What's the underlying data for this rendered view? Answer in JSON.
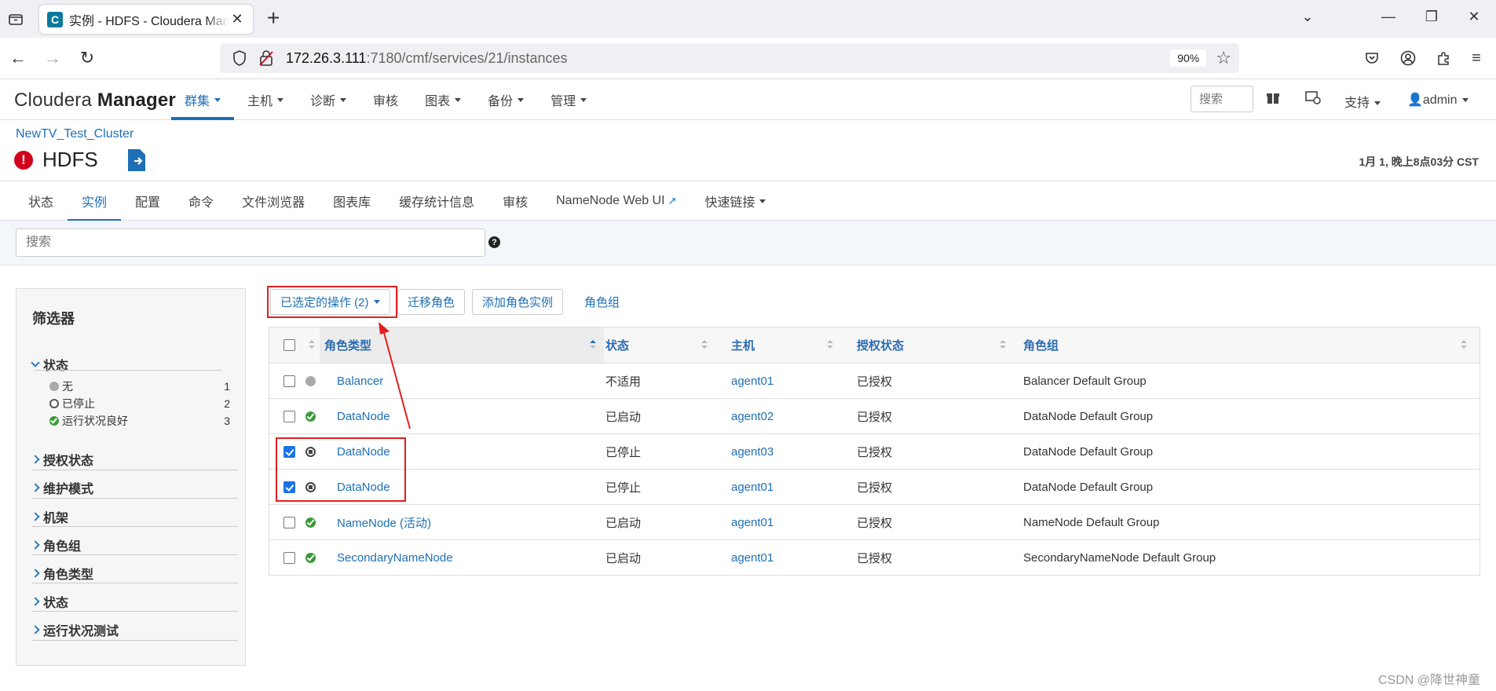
{
  "browser": {
    "tab_title": "实例 - HDFS - Cloudera Manager",
    "url_host": "172.26.3.111",
    "url_path": ":7180/cmf/services/21/instances",
    "zoom": "90%"
  },
  "header": {
    "logo_light": "Cloudera ",
    "logo_bold": "Manager",
    "nav": [
      {
        "label": "群集"
      },
      {
        "label": "主机"
      },
      {
        "label": "诊断"
      },
      {
        "label": "审核"
      },
      {
        "label": "图表"
      },
      {
        "label": "备份"
      },
      {
        "label": "管理"
      }
    ],
    "search_placeholder": "搜索",
    "support": "支持",
    "user": "admin"
  },
  "page": {
    "breadcrumb": "NewTV_Test_Cluster",
    "service": "HDFS",
    "timestamp": "1月 1, 晚上8点03分 CST"
  },
  "subtabs": [
    {
      "label": "状态"
    },
    {
      "label": "实例"
    },
    {
      "label": "配置"
    },
    {
      "label": "命令"
    },
    {
      "label": "文件浏览器"
    },
    {
      "label": "图表库"
    },
    {
      "label": "缓存统计信息"
    },
    {
      "label": "审核"
    },
    {
      "label": "NameNode Web UI"
    },
    {
      "label": "快速链接"
    }
  ],
  "search": {
    "placeholder": "搜索"
  },
  "filters": {
    "title": "筛选器",
    "open_section": "状态",
    "facets": [
      {
        "label": "无",
        "count": "1"
      },
      {
        "label": "已停止",
        "count": "2"
      },
      {
        "label": "运行状况良好",
        "count": "3"
      }
    ],
    "sections": [
      "授权状态",
      "维护模式",
      "机架",
      "角色组",
      "角色类型",
      "状态",
      "运行状况测试"
    ]
  },
  "actions": {
    "selected": "已选定的操作 (2)",
    "migrate": "迁移角色",
    "add": "添加角色实例",
    "groups": "角色组"
  },
  "table": {
    "columns": [
      "角色类型",
      "状态",
      "主机",
      "授权状态",
      "角色组"
    ],
    "rows": [
      {
        "checked": false,
        "health": "na",
        "type": "Balancer",
        "state": "不适用",
        "host": "agent01",
        "auth": "已授权",
        "group": "Balancer Default Group"
      },
      {
        "checked": false,
        "health": "good",
        "type": "DataNode",
        "state": "已启动",
        "host": "agent02",
        "auth": "已授权",
        "group": "DataNode Default Group"
      },
      {
        "checked": true,
        "health": "stopped",
        "type": "DataNode",
        "state": "已停止",
        "host": "agent03",
        "auth": "已授权",
        "group": "DataNode Default Group"
      },
      {
        "checked": true,
        "health": "stopped",
        "type": "DataNode",
        "state": "已停止",
        "host": "agent01",
        "auth": "已授权",
        "group": "DataNode Default Group"
      },
      {
        "checked": false,
        "health": "good",
        "type": "NameNode (活动)",
        "state": "已启动",
        "host": "agent01",
        "auth": "已授权",
        "group": "NameNode Default Group"
      },
      {
        "checked": false,
        "health": "good",
        "type": "SecondaryNameNode",
        "state": "已启动",
        "host": "agent01",
        "auth": "已授权",
        "group": "SecondaryNameNode Default Group"
      }
    ]
  },
  "watermark": "CSDN @降世神童",
  "colors": {
    "accent": "#1f6fb5",
    "highlight": "#e02020",
    "good": "#3a9a3a",
    "error": "#d0021b"
  }
}
